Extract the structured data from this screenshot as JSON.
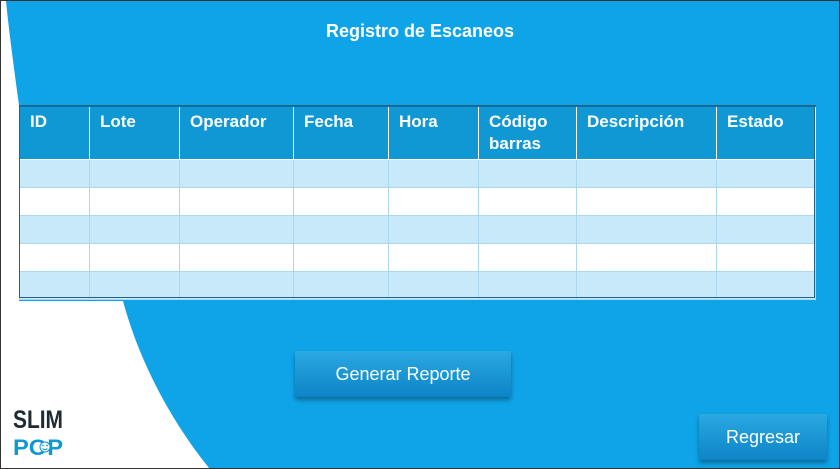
{
  "header": {
    "title": "Registro de Escaneos"
  },
  "table": {
    "columns": [
      "ID",
      "Lote",
      "Operador",
      "Fecha",
      "Hora",
      "Código barras",
      "Descripción",
      "Estado"
    ],
    "rows": [
      [
        "",
        "",
        "",
        "",
        "",
        "",
        "",
        ""
      ],
      [
        "",
        "",
        "",
        "",
        "",
        "",
        "",
        ""
      ],
      [
        "",
        "",
        "",
        "",
        "",
        "",
        "",
        ""
      ],
      [
        "",
        "",
        "",
        "",
        "",
        "",
        "",
        ""
      ],
      [
        "",
        "",
        "",
        "",
        "",
        "",
        "",
        ""
      ]
    ]
  },
  "buttons": {
    "report_label": "Generar Reporte",
    "back_label": "Regresar"
  },
  "logo": {
    "line1": "SLIM",
    "line2": "POP"
  },
  "colors": {
    "background_blue": "#0fa4e8",
    "header_blue": "#0f98d4",
    "row_light_blue": "#c8e9f9"
  }
}
